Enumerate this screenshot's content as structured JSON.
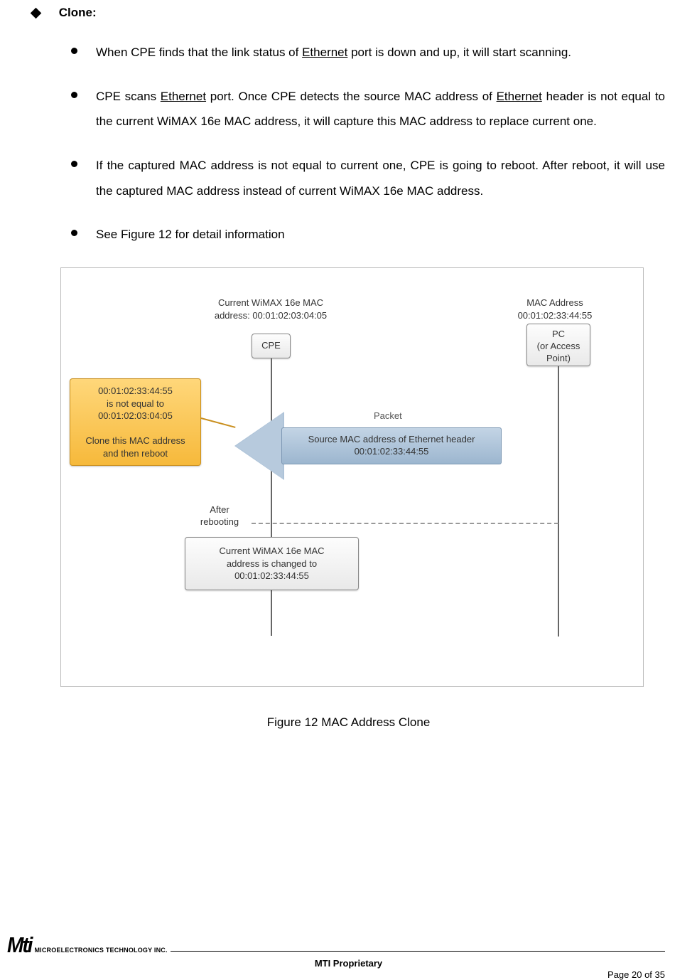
{
  "section": {
    "title": "Clone:"
  },
  "bullets": [
    {
      "pre": "When CPE finds that the link status of ",
      "u": "Ethernet",
      "post": " port is down and up, it will start scanning."
    },
    {
      "pre": "CPE scans ",
      "u": "Ethernet",
      "mid": " port. Once CPE detects the source MAC address of ",
      "u2": "Ethernet",
      "post": " header is not equal to the current WiMAX 16e MAC address, it will capture this MAC address to replace current one."
    },
    {
      "text": "If the captured MAC address is not equal to current one, CPE is going to reboot. After reboot, it will use the captured MAC address instead of current WiMAX 16e MAC address."
    },
    {
      "text": "See Figure 12 for detail information"
    }
  ],
  "figure": {
    "cpe_label": "Current WiMAX 16e MAC\naddress: 00:01:02:03:04:05",
    "pc_label": "MAC Address\n00:01:02:33:44:55",
    "cpe_box": "CPE",
    "pc_box": "PC\n(or Access\nPoint)",
    "note": "00:01:02:33:44:55\nis not equal to\n00:01:02:03:04:05\n\nClone this MAC address\nand then reboot",
    "packet_label": "Packet",
    "packet_body": "Source MAC address of Ethernet header\n00:01:02:33:44:55",
    "after": "After\nrebooting",
    "result": "Current WiMAX 16e MAC\naddress is changed to\n00:01:02:33:44:55",
    "caption": "Figure 12    MAC Address Clone"
  },
  "footer": {
    "logo_main": "Mti",
    "logo_sub": "MICROELECTRONICS TECHNOLOGY INC.",
    "center": "MTI Proprietary",
    "page": "Page 20 of 35"
  }
}
